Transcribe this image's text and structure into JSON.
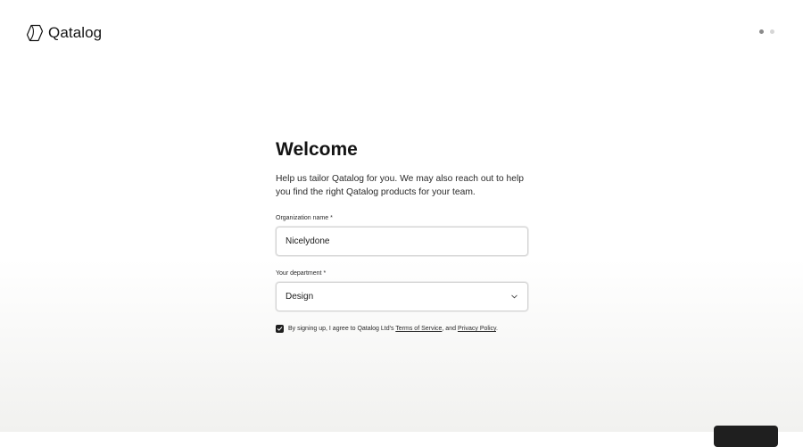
{
  "brand": {
    "name": "Qatalog",
    "logo_icon": "hexagon-logo-icon"
  },
  "progress": {
    "current_step": 1,
    "total_steps": 2
  },
  "form": {
    "title": "Welcome",
    "intro": "Help us tailor Qatalog for you. We may also reach out to help you find the right Qatalog products for your team.",
    "organization": {
      "label": "Organization name *",
      "value": "Nicelydone"
    },
    "department": {
      "label": "Your department *",
      "value": "Design",
      "icon": "chevron-down-icon"
    },
    "agreement": {
      "checked": true,
      "text_before": "By signing up, I agree to Qatalog Ltd's",
      "terms_link": "Terms of Service",
      "separator": ", and",
      "privacy_link": "Privacy Policy",
      "text_after": "."
    }
  },
  "colors": {
    "text": "#1b1b1b",
    "button": "#1f1f1f",
    "field_border": "#d4d4d4",
    "dot_active": "#8a8a8a",
    "dot_inactive": "#d6d6d6"
  }
}
